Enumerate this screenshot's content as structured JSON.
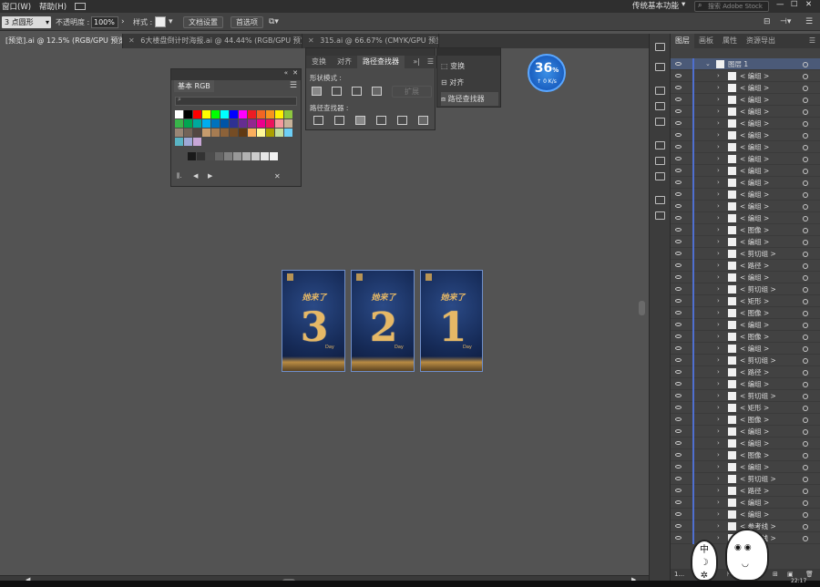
{
  "menubar": {
    "items": [
      "窗口(W)",
      "帮助(H)"
    ]
  },
  "controlbar": {
    "stroke_weight": "3 点圆形",
    "opacity_label": "不透明度 :",
    "opacity_value": "100%",
    "style_label": "样式 :",
    "doc_setup": "文档设置",
    "preferences": "首选项",
    "workspace": "传统基本功能",
    "search_placeholder": "搜索 Adobe Stock"
  },
  "tabs": [
    {
      "label": "[预览].ai @ 12.5% (RGB/GPU 预览)",
      "active": true
    },
    {
      "label": "6大楼盘倒计时海报.ai @ 44.44% (RGB/GPU 预览)",
      "active": false
    },
    {
      "label": "315.ai @ 66.67% (CMYK/GPU 预览)",
      "active": false
    }
  ],
  "swatches": {
    "title": "基本 RGB",
    "colors_row1": [
      "#ffffff",
      "#000000",
      "#ff0000",
      "#ffff00",
      "#00ff00",
      "#00ffff",
      "#0000ff",
      "#ff00ff",
      "#ed1c24",
      "#f26522",
      "#f7941d",
      "#fff200",
      "#8dc63f"
    ],
    "colors_row2": [
      "#39b54a",
      "#00a651",
      "#00a99d",
      "#00aeef",
      "#0072bc",
      "#0054a6",
      "#2e3192",
      "#662d91",
      "#92278f",
      "#ec008c",
      "#ed145b",
      "#f5989d",
      "#c7b299"
    ],
    "colors_row3": [
      "#998675",
      "#736357",
      "#534741",
      "#c69c6d",
      "#a67c52",
      "#8c6239",
      "#754c24",
      "#603913",
      "#fbaf5d",
      "#fff799",
      "#aba000",
      "#c4df9b",
      "#6dcff6"
    ],
    "colors_row4": [
      "#5ab4c4",
      "#9fa8d6",
      "#c8a6d6"
    ],
    "grays": [
      "#1a1a1a",
      "#333333",
      "#4d4d4d",
      "#666666",
      "#808080",
      "#999999",
      "#b3b3b3",
      "#cccccc",
      "#e6e6e6",
      "#f2f2f2"
    ]
  },
  "pathfinder": {
    "tabs": [
      "变换",
      "对齐",
      "路径查找器"
    ],
    "shape_modes_label": "形状模式 :",
    "expand_label": "扩展",
    "pathfinders_label": "路径查找器 :"
  },
  "flyout": {
    "items": [
      "变换",
      "对齐",
      "路径查找器"
    ]
  },
  "gauge": {
    "percent": "36",
    "unit": "%",
    "speed": "0 K/s"
  },
  "posters": [
    {
      "title": "她来了",
      "digit": "3",
      "tag": "Day"
    },
    {
      "title": "她来了",
      "digit": "2",
      "tag": "Day"
    },
    {
      "title": "她来了",
      "digit": "1",
      "tag": "Day"
    }
  ],
  "layers": {
    "tabs": [
      "图层",
      "画板",
      "属性",
      "资源导出"
    ],
    "rows": [
      {
        "label": "图层 1",
        "depth": 0
      },
      {
        "label": "< 编组 >"
      },
      {
        "label": "< 编组 >"
      },
      {
        "label": "< 编组 >"
      },
      {
        "label": "< 编组 >"
      },
      {
        "label": "< 编组 >"
      },
      {
        "label": "< 编组 >"
      },
      {
        "label": "< 编组 >"
      },
      {
        "label": "< 编组 >"
      },
      {
        "label": "< 编组 >"
      },
      {
        "label": "< 编组 >"
      },
      {
        "label": "< 编组 >"
      },
      {
        "label": "< 编组 >"
      },
      {
        "label": "< 编组 >"
      },
      {
        "label": "< 图像 >"
      },
      {
        "label": "< 编组 >"
      },
      {
        "label": "< 剪切组 >"
      },
      {
        "label": "< 路径 >"
      },
      {
        "label": "< 编组 >"
      },
      {
        "label": "< 剪切组 >"
      },
      {
        "label": "< 矩形 >"
      },
      {
        "label": "< 图像 >"
      },
      {
        "label": "< 编组 >"
      },
      {
        "label": "< 图像 >"
      },
      {
        "label": "< 编组 >"
      },
      {
        "label": "< 剪切组 >"
      },
      {
        "label": "< 路径 >"
      },
      {
        "label": "< 编组 >"
      },
      {
        "label": "< 剪切组 >"
      },
      {
        "label": "< 矩形 >"
      },
      {
        "label": "< 图像 >"
      },
      {
        "label": "< 编组 >"
      },
      {
        "label": "< 编组 >"
      },
      {
        "label": "< 图像 >"
      },
      {
        "label": "< 编组 >"
      },
      {
        "label": "< 剪切组 >"
      },
      {
        "label": "< 路径 >"
      },
      {
        "label": "< 编组 >"
      },
      {
        "label": "< 编组 >"
      },
      {
        "label": "< 参考线 >"
      },
      {
        "label": "< 参考线 >"
      }
    ],
    "count_label": "1..."
  },
  "taskbar": {
    "time": "22:17"
  }
}
